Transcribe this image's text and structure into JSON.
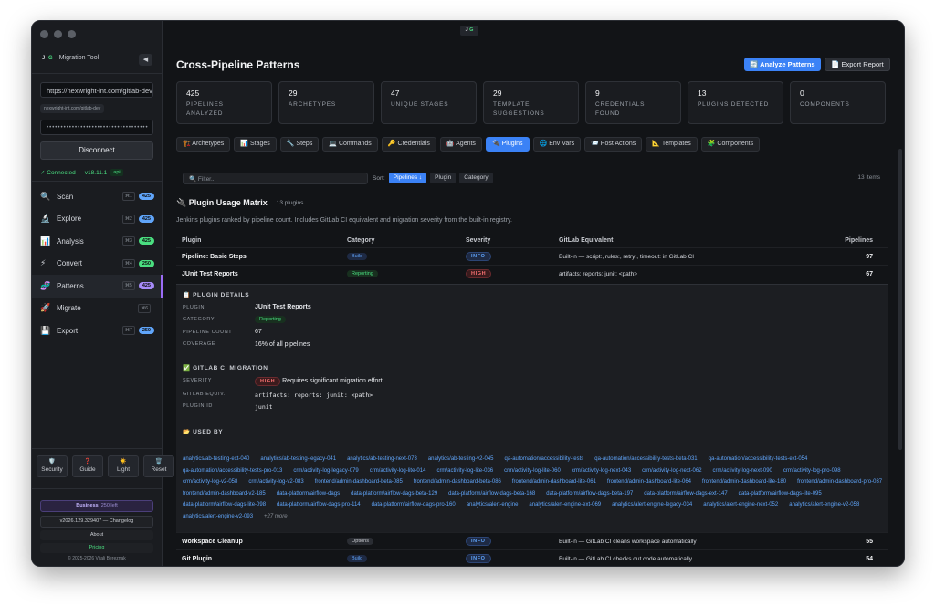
{
  "app": {
    "name": "Migration Tool",
    "logo": "J G",
    "top_badge": "J G"
  },
  "connection": {
    "url": "https://nexwright-int.com/gitlab-dev",
    "url_hint": "nexwright-int.com/gitlab-dev",
    "token": "••••••••••••••••••••••••••••••••••••",
    "disconnect_label": "Disconnect",
    "status": "✓ Connected — v18.11.1",
    "api_tag": "api"
  },
  "nav": [
    {
      "icon": "🔍",
      "label": "Scan",
      "key": "⌘1",
      "badge": "425",
      "badge_color": "#60a5fa"
    },
    {
      "icon": "🔬",
      "label": "Explore",
      "key": "⌘2",
      "badge": "425",
      "badge_color": "#60a5fa"
    },
    {
      "icon": "📊",
      "label": "Analysis",
      "key": "⌘3",
      "badge": "425",
      "badge_color": "#4ade80"
    },
    {
      "icon": "⚡",
      "label": "Convert",
      "key": "⌘4",
      "badge": "250",
      "badge_color": "#4ade80"
    },
    {
      "icon": "🧬",
      "label": "Patterns",
      "key": "⌘5",
      "badge": "425",
      "badge_color": "#a78bfa"
    },
    {
      "icon": "🚀",
      "label": "Migrate",
      "key": "⌘6",
      "badge": "",
      "badge_color": ""
    },
    {
      "icon": "💾",
      "label": "Export",
      "key": "⌘7",
      "badge": "250",
      "badge_color": "#60a5fa"
    }
  ],
  "tools": [
    {
      "icon": "🛡️",
      "label": "Security"
    },
    {
      "icon": "❓",
      "label": "Guide"
    },
    {
      "icon": "☀️",
      "label": "Light"
    },
    {
      "icon": "🗑️",
      "label": "Reset"
    }
  ],
  "footer": {
    "plan": "Business",
    "plan_left": "250 left",
    "version": "v2026.129.329407 — Changelog",
    "about": "About",
    "pricing": "Pricing",
    "copyright": "© 2025-2026 Vitali Bereznak"
  },
  "page": {
    "title": "Cross-Pipeline Patterns",
    "analyze_label": "Analyze Patterns",
    "export_label": "Export Report"
  },
  "stats": [
    {
      "value": "425",
      "label": "Pipelines Analyzed"
    },
    {
      "value": "29",
      "label": "Archetypes"
    },
    {
      "value": "47",
      "label": "Unique Stages"
    },
    {
      "value": "29",
      "label": "Template Suggestions"
    },
    {
      "value": "9",
      "label": "Credentials Found"
    },
    {
      "value": "13",
      "label": "Plugins Detected"
    },
    {
      "value": "0",
      "label": "Components"
    }
  ],
  "tabs": [
    {
      "label": "🏗️ Archetypes",
      "active": false
    },
    {
      "label": "📊 Stages",
      "active": false
    },
    {
      "label": "🔧 Steps",
      "active": false
    },
    {
      "label": "💻 Commands",
      "active": false
    },
    {
      "label": "🔑 Credentials",
      "active": false
    },
    {
      "label": "🤖 Agents",
      "active": false
    },
    {
      "label": "🔌 Plugins",
      "active": true
    },
    {
      "label": "🌐 Env Vars",
      "active": false
    },
    {
      "label": "📨 Post Actions",
      "active": false
    },
    {
      "label": "📐 Templates",
      "active": false
    },
    {
      "label": "🧩 Components",
      "active": false
    }
  ],
  "toolbar": {
    "filter_placeholder": "🔍 Filter...",
    "sort_label": "Sort:",
    "sort_options": [
      "Pipelines ↓",
      "Plugin",
      "Category"
    ],
    "count": "13 items"
  },
  "section": {
    "title": "🔌 Plugin Usage Matrix",
    "count": "13 plugins",
    "description": "Jenkins plugins ranked by pipeline count. Includes GitLab CI equivalent and migration severity from the built-in registry."
  },
  "table": {
    "headers": [
      "Plugin",
      "Category",
      "Severity",
      "GitLab Equivalent",
      "Pipelines"
    ],
    "rows_before": [
      {
        "plugin": "Pipeline: Basic Steps",
        "category": "Build",
        "cat_class": "build",
        "severity": "INFO",
        "sev_class": "info",
        "equiv": "Built-in — script:, rules:, retry:, timeout: in GitLab CI",
        "pipelines": "97"
      },
      {
        "plugin": "JUnit Test Reports",
        "category": "Reporting",
        "cat_class": "reporting",
        "severity": "HIGH",
        "sev_class": "high",
        "equiv": "artifacts: reports: junit: <path>",
        "pipelines": "67"
      }
    ],
    "rows_after": [
      {
        "plugin": "Workspace Cleanup",
        "category": "Options",
        "cat_class": "options",
        "severity": "INFO",
        "sev_class": "info",
        "equiv": "Built-in — GitLab CI cleans workspace automatically",
        "pipelines": "55"
      },
      {
        "plugin": "Git Plugin",
        "category": "Build",
        "cat_class": "build",
        "severity": "INFO",
        "sev_class": "info",
        "equiv": "Built-in — GitLab CI checks out code automatically",
        "pipelines": "54"
      }
    ]
  },
  "details": {
    "plugin_heading": "📋 PLUGIN DETAILS",
    "plugin_label": "PLUGIN",
    "plugin_value": "JUnit Test Reports",
    "category_label": "CATEGORY",
    "category_value": "Reporting",
    "count_label": "PIPELINE COUNT",
    "count_value": "67",
    "coverage_label": "COVERAGE",
    "coverage_value": "16% of all pipelines",
    "migration_heading": "✅ GITLAB CI MIGRATION",
    "severity_label": "SEVERITY",
    "severity_value": "HIGH",
    "severity_text": "Requires significant migration effort",
    "equiv_label": "GITLAB EQUIV.",
    "equiv_value": "artifacts: reports: junit: <path>",
    "id_label": "PLUGIN ID",
    "id_value": "junit",
    "used_heading": "📂 USED BY",
    "used_by": [
      "analytics/ab-testing-ext-040",
      "analytics/ab-testing-legacy-041",
      "analytics/ab-testing-next-073",
      "analytics/ab-testing-v2-045",
      "qa-automation/accessibility-tests",
      "qa-automation/accessibility-tests-beta-031",
      "qa-automation/accessibility-tests-ext-054",
      "qa-automation/accessibility-tests-pro-013",
      "crm/activity-log-legacy-079",
      "crm/activity-log-lite-014",
      "crm/activity-log-lite-036",
      "crm/activity-log-lite-060",
      "crm/activity-log-next-043",
      "crm/activity-log-next-062",
      "crm/activity-log-next-090",
      "crm/activity-log-pro-098",
      "crm/activity-log-v2-058",
      "crm/activity-log-v2-083",
      "frontend/admin-dashboard-beta-085",
      "frontend/admin-dashboard-beta-086",
      "frontend/admin-dashboard-lite-061",
      "frontend/admin-dashboard-lite-064",
      "frontend/admin-dashboard-lite-180",
      "frontend/admin-dashboard-pro-037",
      "frontend/admin-dashboard-v2-185",
      "data-platform/airflow-dags",
      "data-platform/airflow-dags-beta-129",
      "data-platform/airflow-dags-beta-168",
      "data-platform/airflow-dags-beta-197",
      "data-platform/airflow-dags-ext-147",
      "data-platform/airflow-dags-lite-095",
      "data-platform/airflow-dags-lite-098",
      "data-platform/airflow-dags-pro-114",
      "data-platform/airflow-dags-pro-160",
      "analytics/alert-engine",
      "analytics/alert-engine-ext-069",
      "analytics/alert-engine-legacy-034",
      "analytics/alert-engine-next-052",
      "analytics/alert-engine-v2-058",
      "analytics/alert-engine-v2-093"
    ],
    "more": "+27 more"
  }
}
